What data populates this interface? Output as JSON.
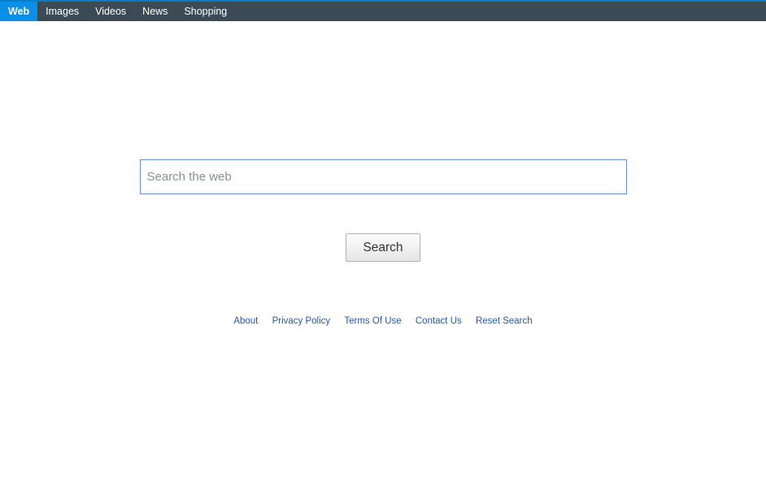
{
  "nav": {
    "items": [
      {
        "label": "Web",
        "active": true
      },
      {
        "label": "Images",
        "active": false
      },
      {
        "label": "Videos",
        "active": false
      },
      {
        "label": "News",
        "active": false
      },
      {
        "label": "Shopping",
        "active": false
      }
    ]
  },
  "search": {
    "placeholder": "Search the web",
    "value": "",
    "button_label": "Search"
  },
  "footer": {
    "links": [
      "About",
      "Privacy Policy",
      "Terms Of Use",
      "Contact Us",
      "Reset Search"
    ]
  }
}
